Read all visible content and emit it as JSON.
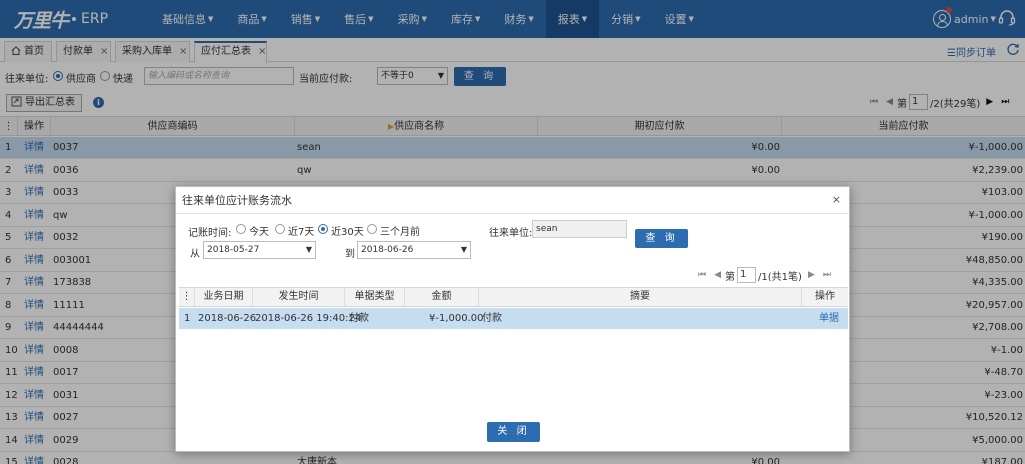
{
  "app": {
    "logo_text": "万里牛",
    "product": "ERP"
  },
  "nav": [
    {
      "label": "基础信息",
      "caret": true,
      "active": false
    },
    {
      "label": "商品",
      "caret": true,
      "active": false
    },
    {
      "label": "销售",
      "caret": true,
      "active": false
    },
    {
      "label": "售后",
      "caret": true,
      "active": false
    },
    {
      "label": "采购",
      "caret": true,
      "active": false
    },
    {
      "label": "库存",
      "caret": true,
      "active": false
    },
    {
      "label": "财务",
      "caret": true,
      "active": false
    },
    {
      "label": "报表",
      "caret": true,
      "active": true
    },
    {
      "label": "分销",
      "caret": true,
      "active": false
    },
    {
      "label": "设置",
      "caret": true,
      "active": false
    }
  ],
  "user": {
    "name": "admin"
  },
  "tabs": [
    {
      "label": "首页",
      "closable": false
    },
    {
      "label": "付款单",
      "closable": true
    },
    {
      "label": "采购入库单",
      "closable": true
    },
    {
      "label": "应付汇总表",
      "closable": true,
      "active": true
    }
  ],
  "sync_label": "同步订单",
  "filter": {
    "party_label": "往来单位:",
    "opt_supplier": "供应商",
    "opt_express": "快递",
    "search_placeholder": "输入编码或名称查询",
    "payable_label": "当前应付款:",
    "payable_value": "不等于0",
    "query_button": "查 询"
  },
  "toolbar": {
    "export_label": "导出汇总表"
  },
  "pager": {
    "page_label": "第",
    "page_value": "1",
    "total_text": "/2(共29笔)"
  },
  "grid": {
    "headers": [
      "操作",
      "供应商编码",
      "供应商名称",
      "期初应付款",
      "当前应付款"
    ],
    "rows": [
      {
        "n": "1",
        "op": "详情",
        "code": "0037",
        "name": "sean",
        "init": "¥0.00",
        "cur": "¥-1,000.00"
      },
      {
        "n": "2",
        "op": "详情",
        "code": "0036",
        "name": "qw",
        "init": "¥0.00",
        "cur": "¥2,239.00"
      },
      {
        "n": "3",
        "op": "详情",
        "code": "0033",
        "name": "",
        "init": "",
        "cur": "¥103.00"
      },
      {
        "n": "4",
        "op": "详情",
        "code": "qw",
        "name": "",
        "init": "",
        "cur": "¥-1,000.00"
      },
      {
        "n": "5",
        "op": "详情",
        "code": "0032",
        "name": "",
        "init": "",
        "cur": "¥190.00"
      },
      {
        "n": "6",
        "op": "详情",
        "code": "003001",
        "name": "",
        "init": "",
        "cur": "¥48,850.00"
      },
      {
        "n": "7",
        "op": "详情",
        "code": "173838",
        "name": "",
        "init": "",
        "cur": "¥4,335.00"
      },
      {
        "n": "8",
        "op": "详情",
        "code": "11111",
        "name": "",
        "init": "",
        "cur": "¥20,957.00"
      },
      {
        "n": "9",
        "op": "详情",
        "code": "44444444",
        "name": "",
        "init": "",
        "cur": "¥2,708.00"
      },
      {
        "n": "10",
        "op": "详情",
        "code": "0008",
        "name": "",
        "init": "",
        "cur": "¥-1.00"
      },
      {
        "n": "11",
        "op": "详情",
        "code": "0017",
        "name": "",
        "init": "",
        "cur": "¥-48.70"
      },
      {
        "n": "12",
        "op": "详情",
        "code": "0031",
        "name": "",
        "init": "",
        "cur": "¥-23.00"
      },
      {
        "n": "13",
        "op": "详情",
        "code": "0027",
        "name": "",
        "init": "",
        "cur": "¥10,520.12"
      },
      {
        "n": "14",
        "op": "详情",
        "code": "0029",
        "name": "",
        "init": "",
        "cur": "¥5,000.00"
      },
      {
        "n": "15",
        "op": "详情",
        "code": "0028",
        "name": "大唐新本",
        "init": "¥0.00",
        "cur": "¥187.00"
      }
    ]
  },
  "modal": {
    "title": "往来单位应计账务流水",
    "date_label": "记账时间:",
    "range_options": [
      "今天",
      "近7天",
      "近30天",
      "三个月前"
    ],
    "range_selected": 2,
    "from_label": "从",
    "from_value": "2018-05-27",
    "to_label": "到",
    "to_value": "2018-06-26",
    "party_label": "往来单位:",
    "party_value": "sean",
    "query_button": "查 询",
    "pager": {
      "page_label": "第",
      "page_value": "1",
      "total_text": "/1(共1笔)"
    },
    "headers": [
      "业务日期",
      "发生时间",
      "单据类型",
      "金额",
      "摘要",
      "操作"
    ],
    "rows": [
      {
        "n": "1",
        "date": "2018-06-26",
        "time": "2018-06-26 19:40:24",
        "type": "付款",
        "amount": "¥-1,000.00",
        "memo": "付款",
        "op": "单据"
      }
    ],
    "close_button": "关 闭"
  }
}
